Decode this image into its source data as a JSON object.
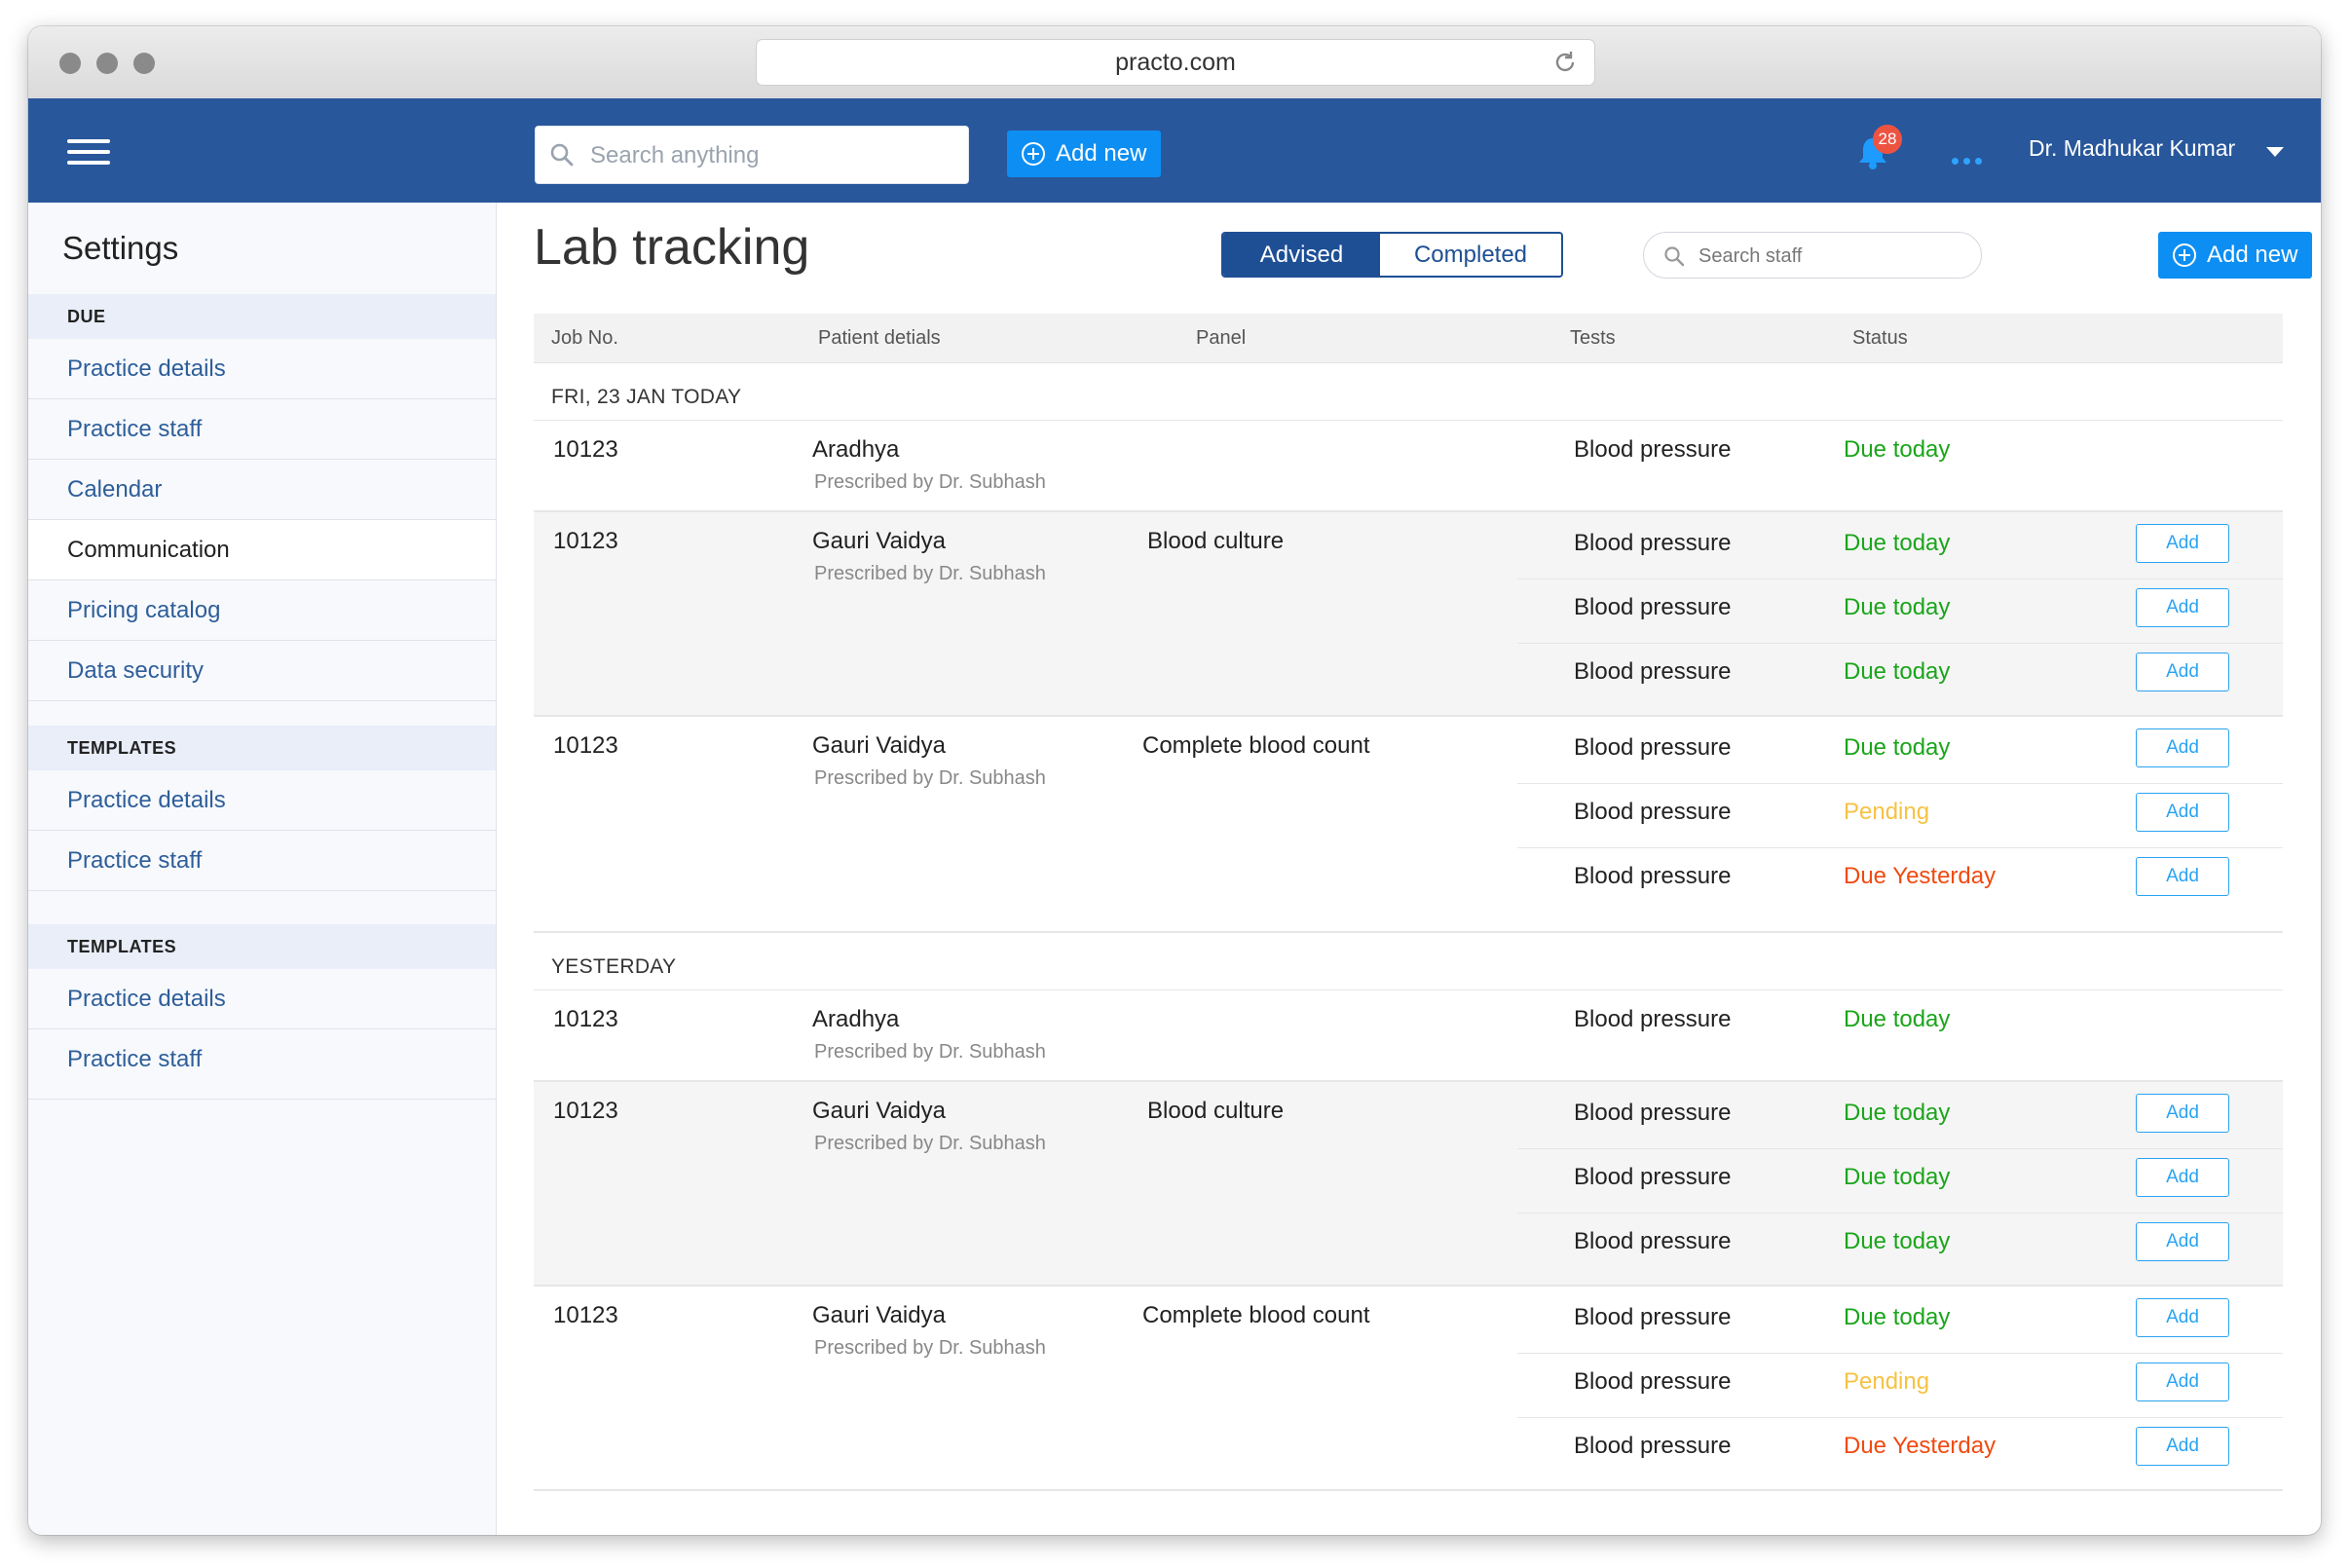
{
  "browser": {
    "url": "practo.com"
  },
  "header": {
    "search_placeholder": "Search anything",
    "add_new_label": "Add new",
    "notification_count": "28",
    "user_name": "Dr. Madhukar Kumar"
  },
  "sidebar": {
    "title": "Settings",
    "sections": [
      {
        "label": "DUE",
        "items": [
          "Practice details",
          "Practice staff",
          "Calendar",
          "Communication",
          "Pricing catalog",
          "Data security"
        ]
      },
      {
        "label": "TEMPLATES",
        "items": [
          "Practice details",
          "Practice staff"
        ]
      },
      {
        "label": "TEMPLATES",
        "items": [
          "Practice details",
          "Practice staff"
        ]
      }
    ],
    "active_item": "Communication"
  },
  "main": {
    "title": "Lab tracking",
    "tabs": [
      "Advised",
      "Completed"
    ],
    "staff_search_placeholder": "Search staff",
    "add_new_label": "Add new",
    "columns": [
      "Job No.",
      "Patient detials",
      "Panel",
      "Tests",
      "Status"
    ],
    "add_label": "Add",
    "groups": [
      {
        "label": "FRI, 23 JAN TODAY",
        "rows": [
          {
            "job": "10123",
            "patient": "Aradhya",
            "prescribed": "Prescribed by Dr. Subhash",
            "panel": "",
            "tests": [
              {
                "test": "Blood pressure",
                "status": "Due today",
                "add": false
              }
            ]
          },
          {
            "job": "10123",
            "patient": "Gauri Vaidya",
            "prescribed": "Prescribed by Dr. Subhash",
            "panel": "Blood culture",
            "tests": [
              {
                "test": "Blood pressure",
                "status": "Due today",
                "add": true
              },
              {
                "test": "Blood pressure",
                "status": "Due today",
                "add": true
              },
              {
                "test": "Blood pressure",
                "status": "Due today",
                "add": true
              }
            ]
          },
          {
            "job": "10123",
            "patient": "Gauri Vaidya",
            "prescribed": "Prescribed by Dr. Subhash",
            "panel": "Complete blood count",
            "tests": [
              {
                "test": "Blood pressure",
                "status": "Due today",
                "add": true
              },
              {
                "test": "Blood pressure",
                "status": "Pending",
                "add": true
              },
              {
                "test": "Blood pressure",
                "status": "Due Yesterday",
                "add": true
              }
            ]
          }
        ]
      },
      {
        "label": "YESTERDAY",
        "rows": [
          {
            "job": "10123",
            "patient": "Aradhya",
            "prescribed": "Prescribed by Dr. Subhash",
            "panel": "",
            "tests": [
              {
                "test": "Blood pressure",
                "status": "Due today",
                "add": false
              }
            ]
          },
          {
            "job": "10123",
            "patient": "Gauri Vaidya",
            "prescribed": "Prescribed by Dr. Subhash",
            "panel": "Blood culture",
            "tests": [
              {
                "test": "Blood pressure",
                "status": "Due today",
                "add": true
              },
              {
                "test": "Blood pressure",
                "status": "Due today",
                "add": true
              },
              {
                "test": "Blood pressure",
                "status": "Due today",
                "add": true
              }
            ]
          },
          {
            "job": "10123",
            "patient": "Gauri Vaidya",
            "prescribed": "Prescribed by Dr. Subhash",
            "panel": "Complete blood count",
            "tests": [
              {
                "test": "Blood pressure",
                "status": "Due today",
                "add": true
              },
              {
                "test": "Blood pressure",
                "status": "Pending",
                "add": true
              },
              {
                "test": "Blood pressure",
                "status": "Due Yesterday",
                "add": true
              }
            ]
          }
        ]
      }
    ]
  },
  "colors": {
    "header_bg": "#28579b",
    "accent": "#0d8ef2",
    "status_due_today": "#1aa51a",
    "status_pending": "#f6c243",
    "status_due_yesterday": "#f04a10",
    "link": "#2e5e99"
  },
  "icons": [
    "hamburger-icon",
    "search-icon",
    "plus-circle-icon",
    "bell-icon",
    "more-icon",
    "chevron-down-icon",
    "reload-icon"
  ]
}
